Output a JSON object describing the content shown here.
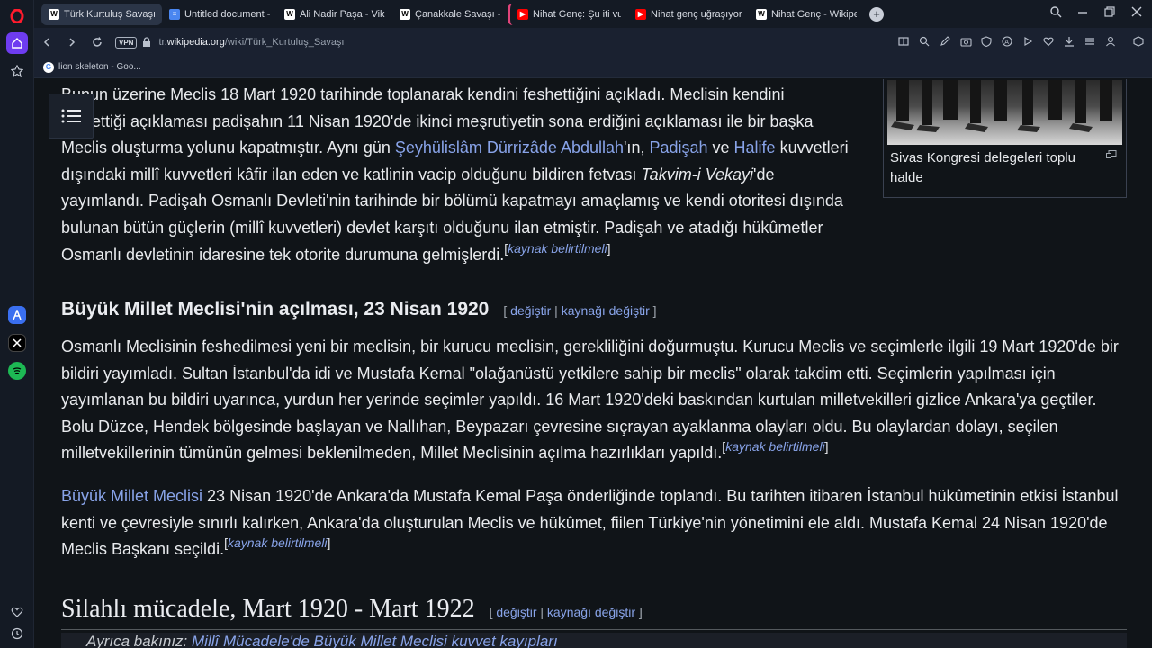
{
  "browser": {
    "tabs": [
      {
        "label": "Türk Kurtuluş Savaşı - Vikipedi",
        "icon": "wikipedia-icon",
        "active": true
      },
      {
        "label": "Untitled document - Google Docs",
        "icon": "google-docs-icon",
        "active": false
      },
      {
        "label": "Ali Nadir Paşa - Vikipedi",
        "icon": "wikipedia-icon",
        "active": false
      },
      {
        "label": "Çanakkale Savaşı - Vikipedi",
        "icon": "wikipedia-icon",
        "active": false
      },
      {
        "label": "Nihat Genç: Şu iti vuracak",
        "icon": "youtube-icon",
        "active": false
      },
      {
        "label": "Nihat genç uğraşıyoruz - YouTube",
        "icon": "youtube-icon",
        "active": false
      },
      {
        "label": "Nihat Genç - Wikipedia",
        "icon": "wikipedia-icon",
        "active": false
      }
    ],
    "vpn_label": "VPN",
    "url_prefix": "tr.",
    "url_domain": "wikipedia.org",
    "url_path": "/wiki/Türk_Kurtuluş_Savaşı",
    "bookmark_label": "lion skeleton - Goo..."
  },
  "article": {
    "p1": {
      "l1": "Bunun üzerine Meclis 18 Mart 1920 tarihinde toplanarak kendini feshettiğini açıkladı. Meclisin kendini",
      "l2": "feshettiği açıklaması padişahın 11 Nisan 1920'de ikinci meşrutiyetin sona erdiğini açıklaması ile bir başka",
      "l3a": "Meclis oluşturma yolunu kapatmıştır. Aynı gün ",
      "l3link1": "Şeyhülislâm Dürrizâde Abdullah",
      "l3b": "'ın, ",
      "l3link2": "Padişah",
      "l3c": " ve ",
      "l3link3": "Halife",
      "l3d": " kuvvetleri",
      "l4a": "dışındaki millî kuvvetleri kâfir ilan eden ve katlinin vacip olduğunu bildiren fetvası ",
      "l4i": "Takvim-i Vekayi",
      "l4b": "'de",
      "l5": "yayımlandı. Padişah Osmanlı Devleti'nin tarihinde bir bölümü kapatmayı amaçlamış ve kendi otoritesi dışında",
      "l6": "bulunan bütün güçlerin (millî kuvvetleri) devlet karşıtı olduğunu ilan etmiştir. Padişah ve atadığı hükûmetler",
      "l7": "Osmanlı devletinin idaresine tek otorite durumuna gelmişlerdi."
    },
    "citation": "kaynak belirtilmeli",
    "thumb_caption": "Sivas Kongresi delegeleri toplu halde",
    "h2_1": "Büyük Millet Meclisi'nin açılması, 23 Nisan 1920",
    "edit_label": "değiştir",
    "edit_source_label": "kaynağı değiştir",
    "p2": {
      "l1": "Osmanlı Meclisinin feshedilmesi yeni bir meclisin, bir kurucu meclisin, gerekliliğini doğurmuştu. Kurucu Meclis ve seçimlerle ilgili 19 Mart 1920'de bir",
      "l2": "bildiri yayımladı. Sultan İstanbul'da idi ve Mustafa Kemal \"olağanüstü yetkilere sahip bir meclis\" olarak takdim etti. Seçimlerin yapılması için",
      "l3": "yayımlanan bu bildiri uyarınca, yurdun her yerinde seçimler yapıldı. 16 Mart 1920'deki baskından kurtulan milletvekilleri gizlice Ankara'ya geçtiler.",
      "l4": "Bolu Düzce, Hendek bölgesinde başlayan ve Nallıhan, Beypazarı çevresine sıçrayan ayaklanma olayları oldu. Bu olaylardan dolayı, seçilen",
      "l5": "milletvekillerinin tümünün gelmesi beklenilmeden, Millet Meclisinin açılma hazırlıkları yapıldı."
    },
    "p3": {
      "link": "Büyük Millet Meclisi",
      "l1": " 23 Nisan 1920'de Ankara'da Mustafa Kemal Paşa önderliğinde toplandı. Bu tarihten itibaren İstanbul hükûmetinin etkisi İstanbul",
      "l2": "kenti ve çevresiyle sınırlı kalırken, Ankara'da oluşturulan Meclis ve hükûmet, fiilen Türkiye'nin yönetimini ele aldı. Mustafa Kemal 24 Nisan 1920'de",
      "l3": "Meclis Başkanı seçildi."
    },
    "h2_2": "Silahlı mücadele, Mart 1920 - Mart 1922",
    "hatnote_prefix": "Ayrıca bakınız: ",
    "hatnote_link": "Millî Mücadele'de Büyük Millet Meclisi kuvvet kayıpları"
  }
}
